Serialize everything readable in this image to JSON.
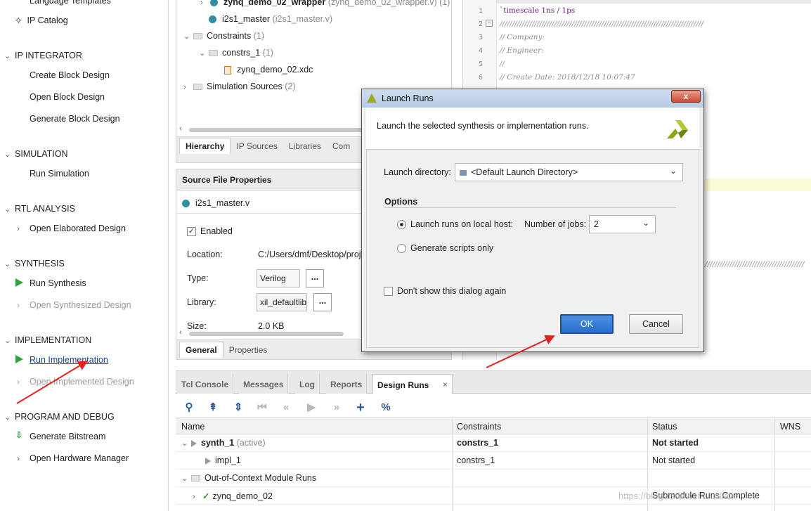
{
  "flow_navigator": {
    "top_partial": "Language Templates",
    "ip_catalog": "IP Catalog",
    "sections": [
      {
        "title": "IP INTEGRATOR",
        "items": [
          "Create Block Design",
          "Open Block Design",
          "Generate Block Design"
        ]
      },
      {
        "title": "SIMULATION",
        "items": [
          "Run Simulation"
        ]
      },
      {
        "title": "RTL ANALYSIS",
        "items": [
          "Open Elaborated Design"
        ]
      },
      {
        "title": "SYNTHESIS",
        "items": [
          "Run Synthesis",
          "Open Synthesized Design"
        ]
      },
      {
        "title": "IMPLEMENTATION",
        "items": [
          "Run Implementation",
          "Open Implemented Design"
        ]
      },
      {
        "title": "PROGRAM AND DEBUG",
        "items": [
          "Generate Bitstream",
          "Open Hardware Manager"
        ]
      }
    ]
  },
  "sources": {
    "rows": [
      {
        "name": "zynq_demo_02_wrapper",
        "detail": "(zynq_demo_02_wrapper.v) (1)"
      },
      {
        "name": "i2s1_master",
        "detail": "(i2s1_master.v)"
      },
      {
        "name": "Constraints",
        "detail": "(1)"
      },
      {
        "name": "constrs_1",
        "detail": "(1)"
      },
      {
        "name": "zynq_demo_02.xdc",
        "detail": ""
      },
      {
        "name": "Simulation Sources",
        "detail": "(2)"
      }
    ],
    "tabs": [
      "Hierarchy",
      "IP Sources",
      "Libraries",
      "Com"
    ]
  },
  "properties": {
    "title": "Source File Properties",
    "file": "i2s1_master.v",
    "enabled_label": "Enabled",
    "location_label": "Location:",
    "location_value": "C:/Users/dmf/Desktop/proj",
    "type_label": "Type:",
    "type_value": "Verilog",
    "library_label": "Library:",
    "library_value": "xil_defaultlib",
    "size_label": "Size:",
    "size_value": "2.0 KB",
    "dots": "...",
    "tabs": [
      "General",
      "Properties"
    ]
  },
  "editor": {
    "line_numbers": [
      "1",
      "2",
      "3",
      "4",
      "5",
      "6"
    ],
    "lines": [
      "`timescale 1ns / 1ps",
      "//////////////////////////////////////////////////////////////////////////////////",
      "// Company:",
      "// Engineer:",
      "//",
      "// Create Date: 2018/12/18 10:07:47"
    ],
    "fragment": "////////////////////////////////////////"
  },
  "dialog": {
    "title": "Launch Runs",
    "close": "x",
    "description": "Launch the selected synthesis or implementation runs.",
    "launch_dir_label": "Launch directory:",
    "launch_dir_value": "<Default Launch Directory>",
    "options_label": "Options",
    "radio_local": "Launch runs on local host:",
    "jobs_label": "Number of jobs:",
    "jobs_value": "2",
    "radio_scripts": "Generate scripts only",
    "dont_show": "Don't show this dialog again",
    "ok": "OK",
    "cancel": "Cancel"
  },
  "bottom": {
    "tabs": [
      "Tcl Console",
      "Messages",
      "Log",
      "Reports",
      "Design Runs"
    ],
    "close": "×",
    "columns": [
      "Name",
      "Constraints",
      "Status",
      "WNS"
    ],
    "rows": [
      {
        "name": "synth_1",
        "suffix": "(active)",
        "constraints": "constrs_1",
        "status": "Not started"
      },
      {
        "name": "impl_1",
        "suffix": "",
        "constraints": "constrs_1",
        "status": "Not started"
      },
      {
        "name": "Out-of-Context Module Runs",
        "suffix": "",
        "constraints": "",
        "status": ""
      },
      {
        "name": "zynq_demo_02",
        "suffix": "",
        "constraints": "",
        "status": "Submodule Runs Complete"
      }
    ]
  },
  "watermark": "https://blog.csdn.net/LiuNian",
  "colors": {
    "accent": "#2a6fc9",
    "play_green": "#2fa33b",
    "arrow_red": "#e0241f"
  }
}
